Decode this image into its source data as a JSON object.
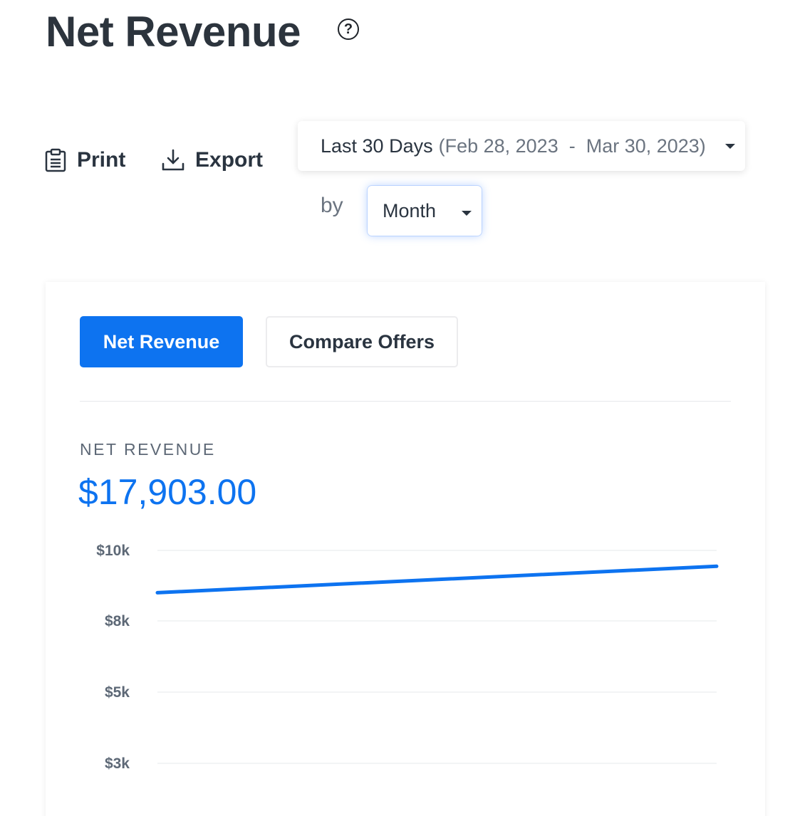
{
  "header": {
    "title": "Net Revenue",
    "help_icon": "?"
  },
  "toolbar": {
    "print_label": "Print",
    "print_icon": "clipboard-icon",
    "export_label": "Export",
    "export_icon": "download-icon"
  },
  "filters": {
    "range_label": "Last 30 Days",
    "range_dates": "(Feb 28, 2023  -  Mar 30, 2023)",
    "by_label": "by",
    "interval_value": "Month"
  },
  "card": {
    "tabs": [
      {
        "label": "Net Revenue",
        "active": true
      },
      {
        "label": "Compare Offers",
        "active": false
      }
    ],
    "metric_label": "NET REVENUE",
    "metric_value": "$17,903.00"
  },
  "colors": {
    "accent": "#0d73f0",
    "text": "#2a3440",
    "muted": "#6b7480",
    "grid": "#e6e8eb"
  },
  "chart_data": {
    "type": "line",
    "title": "",
    "xlabel": "",
    "ylabel": "",
    "yticks": [
      {
        "label": "$10k",
        "value": 10000
      },
      {
        "label": "$8k",
        "value": 8000
      },
      {
        "label": "$5k",
        "value": 5000
      },
      {
        "label": "$3k",
        "value": 3000
      }
    ],
    "ylim": [
      3000,
      10000
    ],
    "grid": true,
    "series": [
      {
        "values": [
          8800,
          9550
        ]
      }
    ]
  }
}
